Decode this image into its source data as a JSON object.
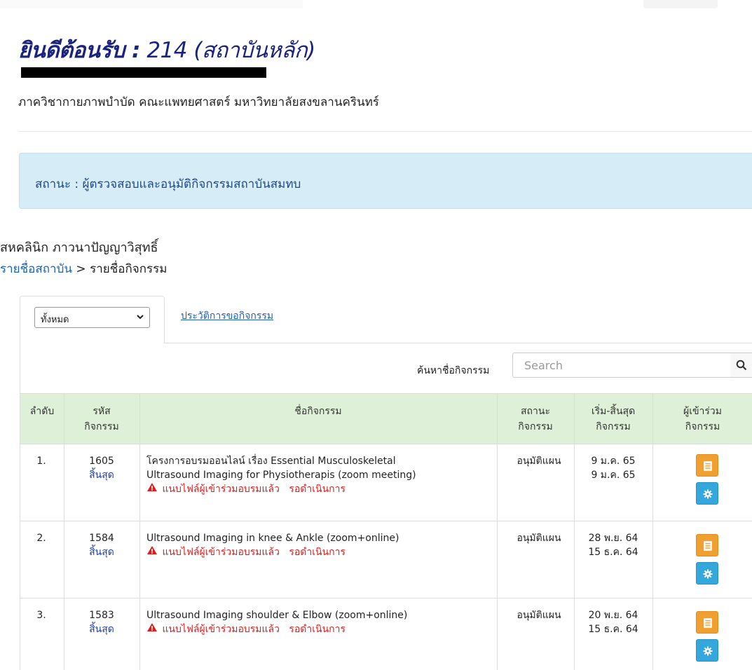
{
  "header": {
    "welcome_label": "ยินดีต้อนรับ :",
    "welcome_value": "214 (สถาบันหลัก)",
    "department": "ภาควิชากายภาพบำบัด คณะแพทยศาสตร์ มหาวิทยาลัยสงขลานครินทร์"
  },
  "status_banner": {
    "text": "สถานะ : ผู้ตรวจสอบและอนุมัติกิจกรรมสถาบันสมทบ"
  },
  "clinic": {
    "name": "สหคลินิก ภาวนาปัญญาวิสุทธิ์"
  },
  "breadcrumb": {
    "link": "รายชื่อสถาบัน",
    "sep": ">",
    "current": "รายชื่อกิจกรรม"
  },
  "tabs": {
    "filter_value": "ทั้งหมด",
    "history_label": "ประวัติการขอกิจกรรม"
  },
  "search": {
    "label": "ค้นหาชื่อกิจกรรม",
    "placeholder": "Search"
  },
  "table": {
    "headers": {
      "order": "ลำดับ",
      "code_1": "รหัส",
      "code_2": "กิจกรรม",
      "name": "ชื่อกิจกรรม",
      "status_1": "สถานะ",
      "status_2": "กิจกรรม",
      "dates_1": "เริ่ม-สิ้นสุด",
      "dates_2": "กิจกรรม",
      "participants_1": "ผู้เข้าร่วม",
      "participants_2": "กิจกรรม"
    },
    "rows": [
      {
        "num": "1.",
        "code": "1605",
        "code_status": "สิ้นสุด",
        "name_1": "โครงการอบรมออนไลน์ เรื่อง Essential Musculoskeletal",
        "name_2": "Ultrasound Imaging for Physiotherapis (zoom meeting)",
        "warning": "แนบไฟล์ผู้เข้าร่วมอบรมแล้ว   รอดำเนินการ",
        "status": "อนุมัติแผน",
        "start": "9 ม.ค. 65",
        "end": "9 ม.ค. 65"
      },
      {
        "num": "2.",
        "code": "1584",
        "code_status": "สิ้นสุด",
        "name_1": "Ultrasound Imaging in knee & Ankle (zoom+online)",
        "warning": "แนบไฟล์ผู้เข้าร่วมอบรมแล้ว   รอดำเนินการ",
        "status": "อนุมัติแผน",
        "start": "28 พ.ย. 64",
        "end": "15 ธ.ค. 64"
      },
      {
        "num": "3.",
        "code": "1583",
        "code_status": "สิ้นสุด",
        "name_1": "Ultrasound Imaging shoulder & Elbow (zoom+online)",
        "warning": "แนบไฟล์ผู้เข้าร่วมอบรมแล้ว   รอดำเนินการ",
        "status": "อนุมัติแผน",
        "start": "20 พ.ย. 64",
        "end": "15 ธ.ค. 64"
      }
    ]
  },
  "colors": {
    "title": "#1a237e",
    "banner_bg": "#d6ecf6",
    "table_header_bg": "#dff0d8",
    "link": "#1f62b0",
    "warning": "#d92020",
    "btn_orange": "#f0a030",
    "btn_blue": "#34a7dc"
  },
  "icons": {
    "search": "search-icon",
    "warning": "warning-triangle-icon",
    "list": "list-icon",
    "gear": "gear-icon",
    "chevron": "chevron-down-icon"
  }
}
